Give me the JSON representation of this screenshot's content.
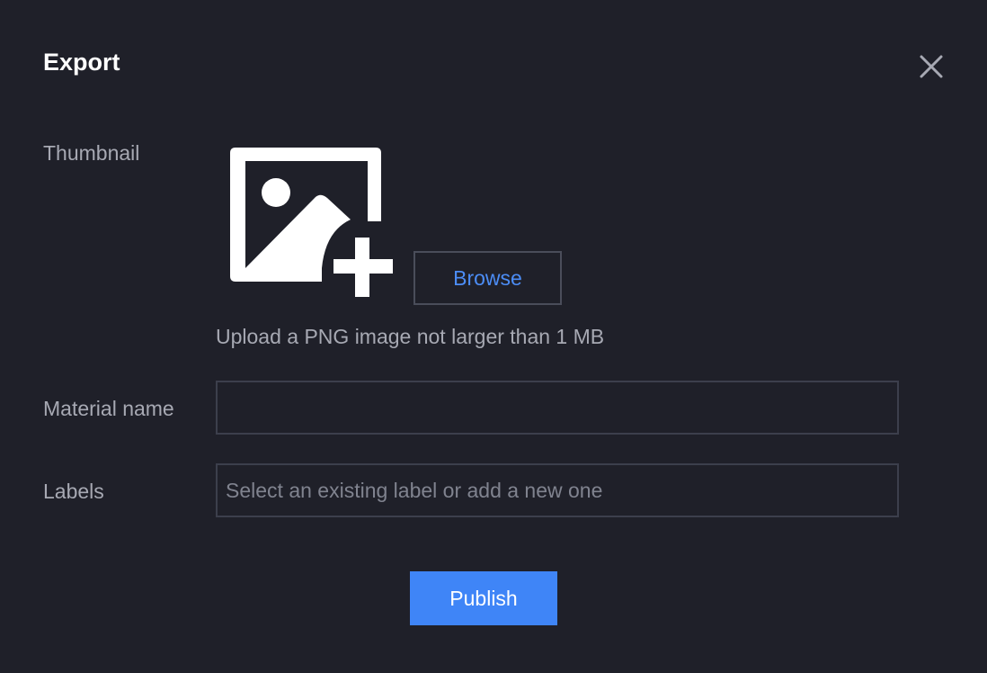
{
  "dialog": {
    "title": "Export",
    "close_icon": "close-icon"
  },
  "thumbnail": {
    "label": "Thumbnail",
    "icon": "add-image-icon",
    "browse_label": "Browse",
    "hint": "Upload a PNG image not larger than 1 MB"
  },
  "material_name": {
    "label": "Material name",
    "value": "",
    "placeholder": ""
  },
  "labels": {
    "label": "Labels",
    "value": "",
    "placeholder": "Select an existing label or add a new one"
  },
  "actions": {
    "publish_label": "Publish"
  },
  "colors": {
    "background": "#1f2029",
    "accent": "#3f85f7",
    "link": "#4c8df6",
    "label_text": "#a7a9b3",
    "border": "#3c3f4c"
  }
}
